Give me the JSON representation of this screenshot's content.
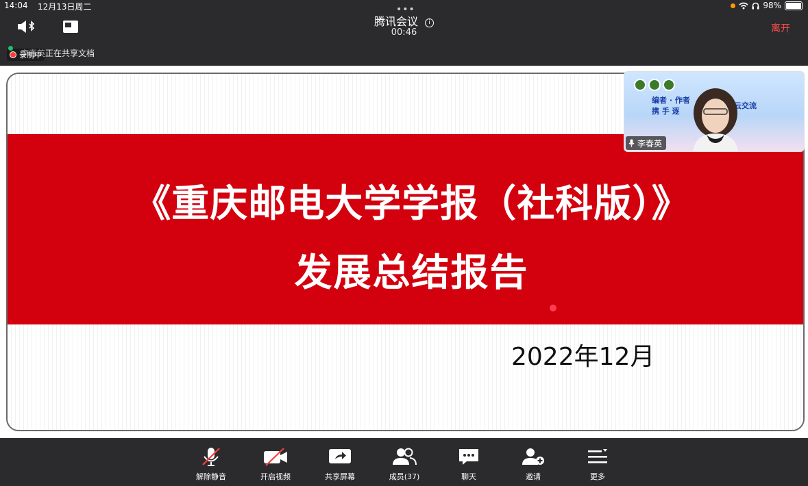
{
  "status_bar": {
    "time": "14:04",
    "date": "12月13日周二",
    "battery": "98%"
  },
  "header": {
    "dots": "•••",
    "app_title": "腾讯会议",
    "info_symbol": "i",
    "elapsed": "00:46",
    "leave_label": "离开",
    "share_status": "李春英正在共享文档",
    "recording_label": "录制中"
  },
  "slide": {
    "title_line1": "《重庆邮电大学学报（社科版）》",
    "title_line2": "发展总结报告",
    "date": "2022年12月"
  },
  "thumbnail": {
    "participant_name": "李春英",
    "bg_text_1": "编者 · 作者",
    "bg_text_2": "云交流",
    "bg_text_3": "携 手 逐"
  },
  "toolbar": {
    "unmute": "解除静音",
    "start_video": "开启视频",
    "share_screen": "共享屏幕",
    "members": "成员(37)",
    "chat": "聊天",
    "invite": "邀请",
    "more": "更多"
  },
  "colors": {
    "banner_red": "#d3000e",
    "leave_red": "#ff4d4d",
    "toolbar_bg": "#2b2b2e"
  }
}
